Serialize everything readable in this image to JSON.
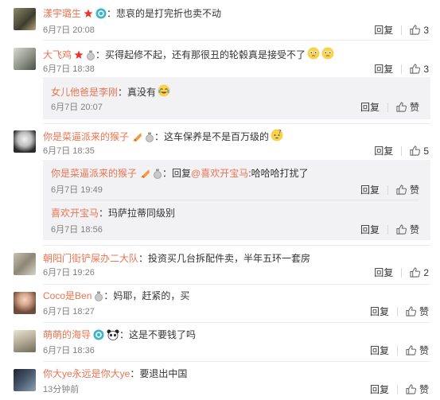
{
  "comments": [
    {
      "user": "漾宇璐生",
      "text": "悲哀的是打完折也卖不动",
      "time": "6月7日 20:08",
      "likes": "3"
    },
    {
      "user": "大飞鸡",
      "text": "买得起修不起，还有那很丑的轮毂真是接受不了",
      "time": "6月7日 18:38",
      "likes": "3",
      "replies": [
        {
          "user": "女儿他爸是李刚",
          "text": "真没有",
          "time": "6月7日 20:07",
          "likes": "赞"
        }
      ]
    },
    {
      "user": "你是菜逼派来的猴子",
      "text": "这车保养是不是百万级的",
      "time": "6月7日 18:35",
      "likes": "5",
      "replies": [
        {
          "user": "你是菜逼派来的猴子",
          "reply_prefix": "回复",
          "reply_target": "@喜欢开宝马",
          "text": ":哈哈哈打扰了",
          "time": "6月7日 19:49",
          "likes": "赞"
        },
        {
          "user": "喜欢开宝马",
          "text": "玛萨拉蒂同级别",
          "time": "6月7日 18:56",
          "likes": "赞"
        }
      ]
    },
    {
      "user": "朝阳门街铲屎办二大队",
      "text": "投资买几台拆配件卖，半年五环一套房",
      "time": "6月7日 19:26",
      "likes": "2"
    },
    {
      "user": "Coco是Ben",
      "text": "妈耶，赶紧的，买",
      "time": "6月7日 18:27",
      "likes": "赞"
    },
    {
      "user": "萌萌的海导",
      "text": "这是不要钱了吗",
      "time": "6月7日 18:36",
      "likes": "赞"
    },
    {
      "user": "你大ye永远是你大ye",
      "text": "要退出中国",
      "time": "13分钟前",
      "likes": "赞"
    }
  ],
  "labels": {
    "reply": "回复",
    "colon": "："
  },
  "colors": {
    "username": "#eb7350",
    "subbox": "#f2f2f5",
    "text": "#333333",
    "meta": "#808080"
  }
}
